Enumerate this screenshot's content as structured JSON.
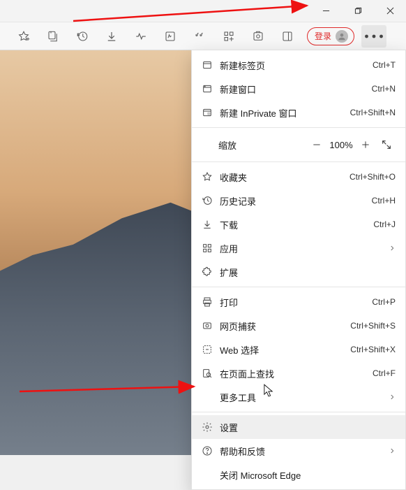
{
  "window": {
    "min_tip": "Minimize",
    "max_tip": "Restore",
    "close_tip": "Close"
  },
  "toolbar": {
    "login_label": "登录"
  },
  "menu": {
    "new_tab": {
      "label": "新建标签页",
      "shortcut": "Ctrl+T"
    },
    "new_window": {
      "label": "新建窗口",
      "shortcut": "Ctrl+N"
    },
    "new_inprivate": {
      "label": "新建 InPrivate 窗口",
      "shortcut": "Ctrl+Shift+N"
    },
    "zoom": {
      "label": "缩放",
      "value": "100%"
    },
    "favorites": {
      "label": "收藏夹",
      "shortcut": "Ctrl+Shift+O"
    },
    "history": {
      "label": "历史记录",
      "shortcut": "Ctrl+H"
    },
    "downloads": {
      "label": "下载",
      "shortcut": "Ctrl+J"
    },
    "apps": {
      "label": "应用"
    },
    "extensions": {
      "label": "扩展"
    },
    "print": {
      "label": "打印",
      "shortcut": "Ctrl+P"
    },
    "web_capture": {
      "label": "网页捕获",
      "shortcut": "Ctrl+Shift+S"
    },
    "web_select": {
      "label": "Web 选择",
      "shortcut": "Ctrl+Shift+X"
    },
    "find": {
      "label": "在页面上查找",
      "shortcut": "Ctrl+F"
    },
    "more_tools": {
      "label": "更多工具"
    },
    "settings": {
      "label": "设置"
    },
    "help": {
      "label": "帮助和反馈"
    },
    "close_edge": {
      "label": "关闭 Microsoft Edge"
    }
  }
}
